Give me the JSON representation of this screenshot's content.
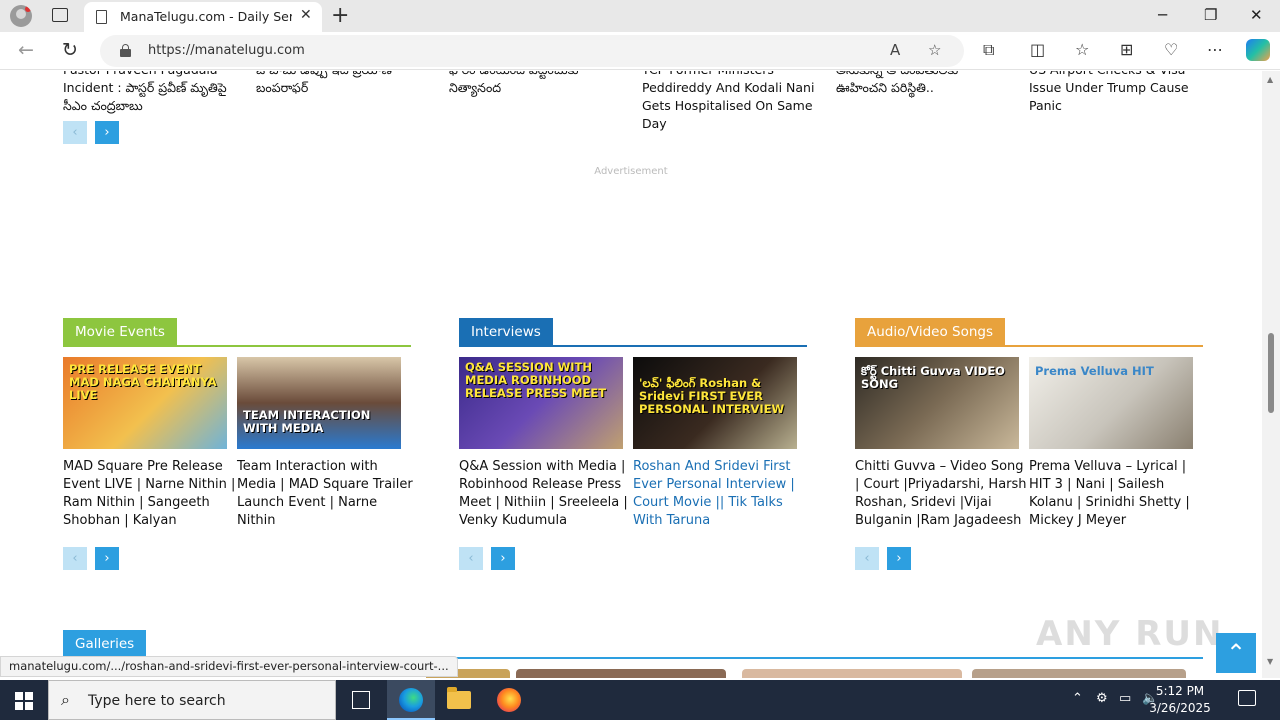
{
  "browser": {
    "tab_title": "ManaTelugu.com - Daily Serials |",
    "tab_close": "✕",
    "new_tab": "+",
    "url": "https://manatelugu.com",
    "win_min": "─",
    "win_restore": "❐",
    "win_close": "✕"
  },
  "top_news": [
    "Pastor Praveen Pagadala Incident : పాస్టర్ ప్రవీణ్ మృతిపై సీఎం చంద్రబాబు",
    "ఓ బాబు ఉప్పు ఇది ప్రయాణ బంపరాఫర్",
    "ఫోరం ఉంటుంది పట్టించుకు నిత్యానంద",
    "YCP Former Ministers Peddireddy And Kodali Nani Gets Hospitalised On Same Day",
    "అనుకున్న ఆ దంపతులకు ఊహించని పరిస్థితి..",
    "US Airport Checks & Visa Issue Under Trump Cause Panic"
  ],
  "carousel": {
    "prev": "‹",
    "next": "›"
  },
  "advertisement_label": "Advertisement",
  "sections": [
    {
      "heading": "Movie Events",
      "color": "#8dc63f",
      "cards": [
        {
          "thumb_caption": "PRE RELEASE EVENT  MAD  NAGA CHAITANYA  LIVE",
          "title": "MAD Square Pre Release Event LIVE | Narne Nithin | Ram Nithin | Sangeeth Shobhan | Kalyan"
        },
        {
          "thumb_caption": "TEAM INTERACTION WITH MEDIA",
          "title": "Team Interaction with Media | MAD Square Trailer Launch Event | Narne Nithin"
        }
      ]
    },
    {
      "heading": "Interviews",
      "color": "#1a6fb4",
      "cards": [
        {
          "thumb_caption": "Q&A SESSION WITH MEDIA  ROBINHOOD  RELEASE PRESS MEET",
          "title": "Q&A Session with Media | Robinhood Release Press Meet | Nithiin | Sreeleela | Venky Kudumula"
        },
        {
          "thumb_caption": "'లవ్' ఫీలింగ్  Roshan & Sridevi  FIRST EVER PERSONAL INTERVIEW",
          "title": "Roshan And Sridevi First Ever Personal Interview | Court Movie || Tik Talks With Taruna"
        }
      ]
    },
    {
      "heading": "Audio/Video Songs",
      "color": "#e8a23c",
      "cards": [
        {
          "thumb_caption": "కోర్ట్  Chitti Guvva  VIDEO SONG",
          "title": "Chitti Guvva – Video Song | Court |Priyadarshi, Harsh Roshan, Sridevi |Vijai Bulganin |Ram Jagadeesh"
        },
        {
          "thumb_caption": "Prema Velluva  HIT",
          "title": "Prema Velluva – Lyrical | HIT 3 | Nani | Sailesh Kolanu | Srinidhi Shetty | Mickey J Meyer"
        }
      ]
    }
  ],
  "galleries_heading": "Galleries",
  "back_to_top": "⌃",
  "watermark": "ANY RUN",
  "status_url": "manatelugu.com/.../roshan-and-sridevi-first-ever-personal-interview-court-...",
  "taskbar": {
    "search_placeholder": "Type here to search",
    "time": "5:12 PM",
    "date": "3/26/2025"
  }
}
